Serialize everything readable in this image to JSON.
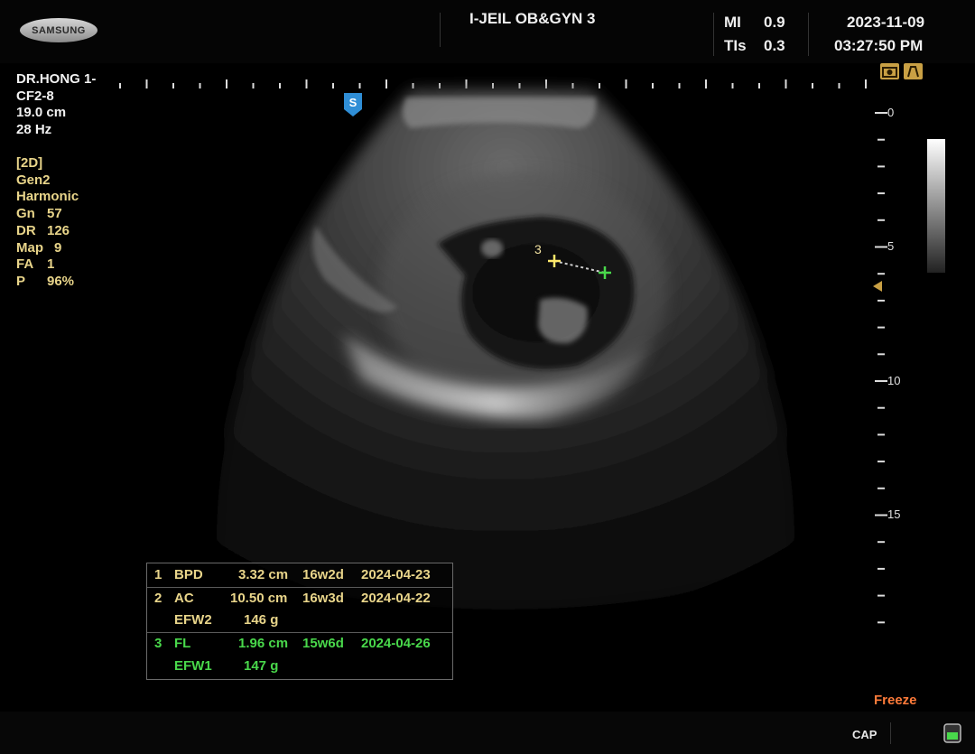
{
  "header": {
    "brand": "SAMSUNG",
    "hospital": "I-JEIL OB&GYN 3",
    "mi_label": "MI",
    "mi_value": "0.9",
    "tis_label": "TIs",
    "tis_value": "0.3",
    "date": "2023-11-09",
    "time": "03:27:50 PM"
  },
  "probe_info": [
    "DR.HONG 1-",
    "CF2-8",
    "19.0 cm",
    "28 Hz"
  ],
  "mode_info": [
    {
      "label": "[2D]",
      "value": ""
    },
    {
      "label": "Gen2",
      "value": ""
    },
    {
      "label": "Harmonic",
      "value": ""
    },
    {
      "label": "Gn",
      "value": "57"
    },
    {
      "label": "DR",
      "value": "126"
    },
    {
      "label": "Map",
      "value": "9"
    },
    {
      "label": "FA",
      "value": "1"
    },
    {
      "label": "P",
      "value": "96%"
    }
  ],
  "depth_scale": {
    "unit_marks": [
      "0",
      "5",
      "10",
      "15"
    ]
  },
  "focus_marker_icon": "triangle-left-icon",
  "scan_marker": "S",
  "caliper_label": "3",
  "measurements": [
    {
      "idx": "1",
      "name": "BPD",
      "value": "3.32 cm",
      "ga": "16w2d",
      "edd": "2024-04-23",
      "color": "#e9d58a"
    },
    {
      "idx": "2",
      "name": "AC",
      "value": "10.50 cm",
      "ga": "16w3d",
      "edd": "2024-04-22",
      "color": "#e9d58a"
    },
    {
      "idx": "",
      "name": "EFW2",
      "value": "146 g",
      "ga": "",
      "edd": "",
      "color": "#e9d58a"
    },
    {
      "idx": "3",
      "name": "FL",
      "value": "1.96 cm",
      "ga": "15w6d",
      "edd": "2024-04-26",
      "color": "#49d84b"
    },
    {
      "idx": "",
      "name": "EFW1",
      "value": "147 g",
      "ga": "",
      "edd": "",
      "color": "#49d84b"
    }
  ],
  "status": {
    "freeze": "Freeze",
    "cap": "CAP"
  },
  "colors": {
    "caliper_yellow": "#ffe96b",
    "caliper_green": "#49d84b",
    "freeze": "#ff7b3a",
    "marker_blue": "#2f8ed6"
  }
}
